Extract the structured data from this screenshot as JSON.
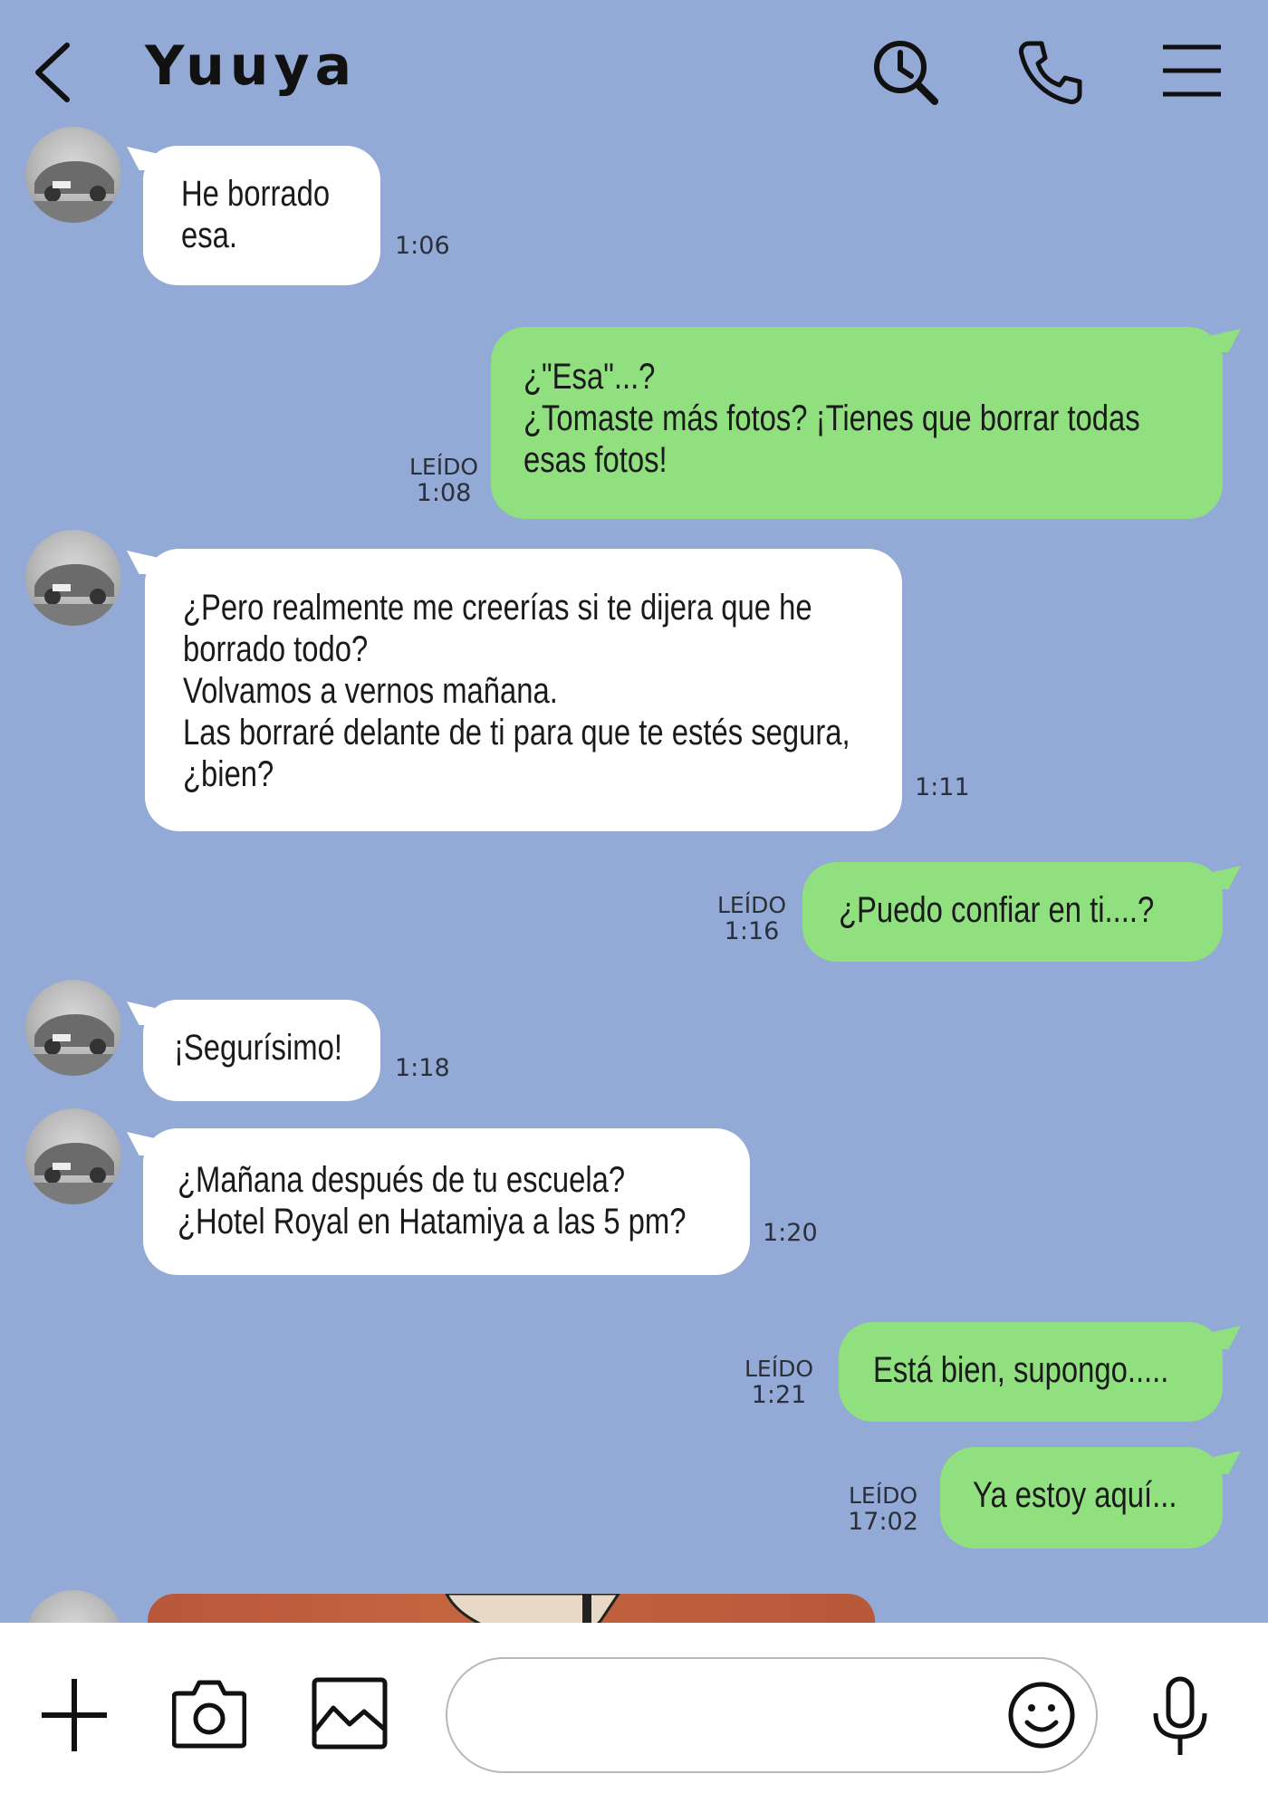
{
  "header": {
    "back_icon": "chevron-left-icon",
    "title": "Yuuya",
    "actions": [
      "history-search-icon",
      "phone-icon",
      "menu-icon"
    ]
  },
  "messages": [
    {
      "side": "in",
      "text": "He borrado\nesa.",
      "time": "1:06"
    },
    {
      "side": "out",
      "text": "¿\"Esa\"...?\n¿Tomaste más fotos? ¡Tienes que borrar todas\nesas fotos!",
      "read": "LEÍDO",
      "time": "1:08"
    },
    {
      "side": "in",
      "text": "¿Pero realmente me creerías si te dijera que he\nborrado todo?\nVolvamos a vernos mañana.\nLas borraré delante de ti para que te estés segura,\n¿bien?",
      "time": "1:11"
    },
    {
      "side": "out",
      "text": "¿Puedo confiar en ti....?",
      "read": "LEÍDO",
      "time": "1:16"
    },
    {
      "side": "in",
      "text": "¡Segurísimo!",
      "time": "1:18"
    },
    {
      "side": "in",
      "text": "¿Mañana después de tu escuela?\n¿Hotel Royal en Hatamiya a las 5 pm?",
      "time": "1:20"
    },
    {
      "side": "out",
      "text": "Está bien, supongo.....",
      "read": "LEÍDO",
      "time": "1:21"
    },
    {
      "side": "out",
      "text": "Ya estoy aquí...",
      "read": "LEÍDO",
      "time": "17:02"
    }
  ],
  "input": {
    "value": "",
    "placeholder": ""
  },
  "toolbar": {
    "icons": [
      "plus-icon",
      "camera-icon",
      "image-icon",
      "emoji-icon",
      "microphone-icon"
    ]
  },
  "colors": {
    "background": "#93a9d6",
    "incoming_bubble": "#ffffff",
    "outgoing_bubble": "#90e080"
  }
}
